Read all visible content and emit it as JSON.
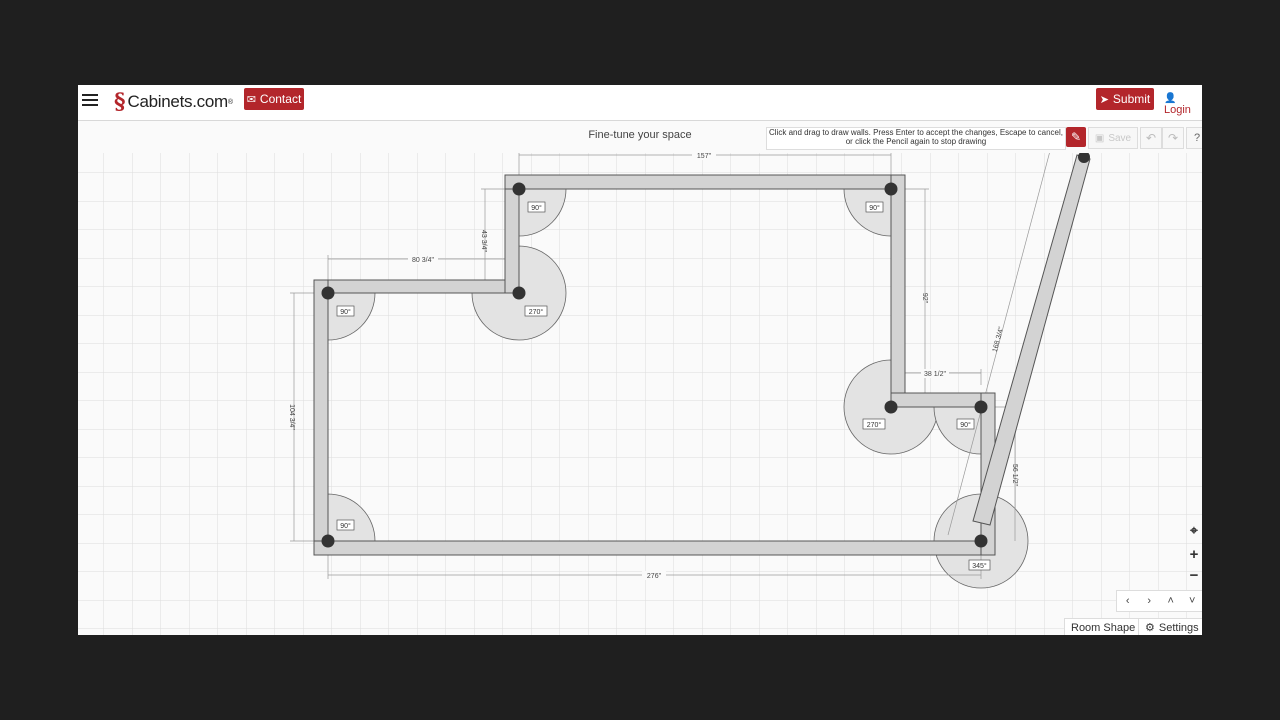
{
  "header": {
    "logo_text": "Cabinets.com",
    "logo_sup": "®",
    "contact_label": "Contact",
    "submit_label": "Submit",
    "login_label": "Login"
  },
  "toolbar": {
    "page_title": "Fine-tune your space",
    "hint": "Click and drag to draw walls. Press Enter to accept the changes, Escape to cancel, or click the Pencil again to stop drawing",
    "save_label": "Save",
    "help_label": "?"
  },
  "plan": {
    "dimensions": [
      "157\"",
      "80 3/4\"",
      "43 3/4\"",
      "92\"",
      "38 1/2\"",
      "168 3/4\"",
      "104 3/4\"",
      "56 1/2\"",
      "276\""
    ],
    "angles": [
      "90°",
      "90°",
      "90°",
      "270°",
      "270°",
      "90°",
      "90°",
      "345°"
    ]
  },
  "bottom": {
    "room_shape_label": "Room Shape",
    "settings_label": "Settings"
  },
  "icons": {
    "menu": "hamburger-icon",
    "contact": "envelope-icon",
    "submit": "paper-plane-icon",
    "login": "user-icon",
    "pencil": "pencil-icon",
    "save": "floppy-icon",
    "undo": "undo-icon",
    "redo": "redo-icon",
    "locate": "crosshair-icon",
    "settings": "gear-icon"
  },
  "colors": {
    "brand_red": "#b3262b",
    "wall_fill": "#d3d3d3",
    "grid": "#dcdcdc"
  }
}
